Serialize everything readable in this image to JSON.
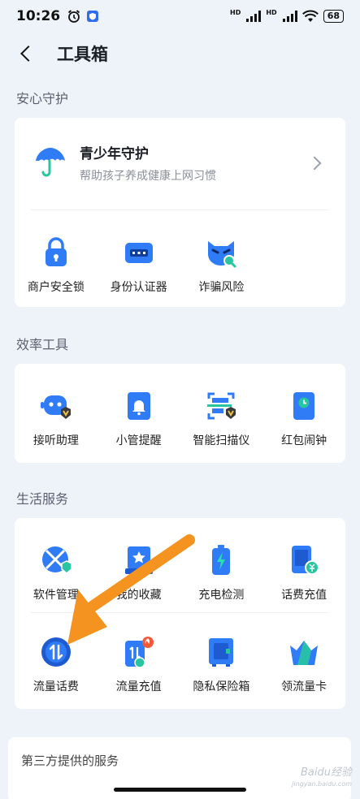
{
  "status": {
    "time": "10:26",
    "battery": "68",
    "hd1": "HD",
    "hd2": "HD"
  },
  "header": {
    "title": "工具箱"
  },
  "sections": {
    "guard": {
      "label": "安心守护",
      "youth": {
        "title": "青少年守护",
        "subtitle": "帮助孩子养成健康上网习惯"
      },
      "items": [
        {
          "label": "商户安全锁",
          "icon": "lock-icon"
        },
        {
          "label": "身份认证器",
          "icon": "id-card-icon"
        },
        {
          "label": "诈骗风险",
          "icon": "fraud-mask-icon"
        }
      ]
    },
    "efficiency": {
      "label": "效率工具",
      "items": [
        {
          "label": "接听助理",
          "icon": "robot-assistant-icon"
        },
        {
          "label": "小管提醒",
          "icon": "bell-icon"
        },
        {
          "label": "智能扫描仪",
          "icon": "scanner-icon"
        },
        {
          "label": "红包闹钟",
          "icon": "clock-icon"
        }
      ]
    },
    "life": {
      "label": "生活服务",
      "row1": [
        {
          "label": "软件管理",
          "icon": "app-manage-icon"
        },
        {
          "label": "我的收藏",
          "icon": "star-folder-icon"
        },
        {
          "label": "充电检测",
          "icon": "battery-charge-icon"
        },
        {
          "label": "话费充值",
          "icon": "phone-recharge-icon"
        }
      ],
      "row2": [
        {
          "label": "流量话费",
          "icon": "data-usage-icon"
        },
        {
          "label": "流量充值",
          "icon": "data-recharge-icon"
        },
        {
          "label": "隐私保险箱",
          "icon": "safe-icon"
        },
        {
          "label": "领流量卡",
          "icon": "crown-card-icon"
        }
      ]
    },
    "third_party": {
      "label": "第三方提供的服务"
    }
  },
  "watermark": {
    "line1": "Baidu经验",
    "line2": "jingyan.baidu.com"
  },
  "colors": {
    "accent": "#2f7cf6",
    "arrow": "#f4931f",
    "background": "#eef3f9"
  }
}
